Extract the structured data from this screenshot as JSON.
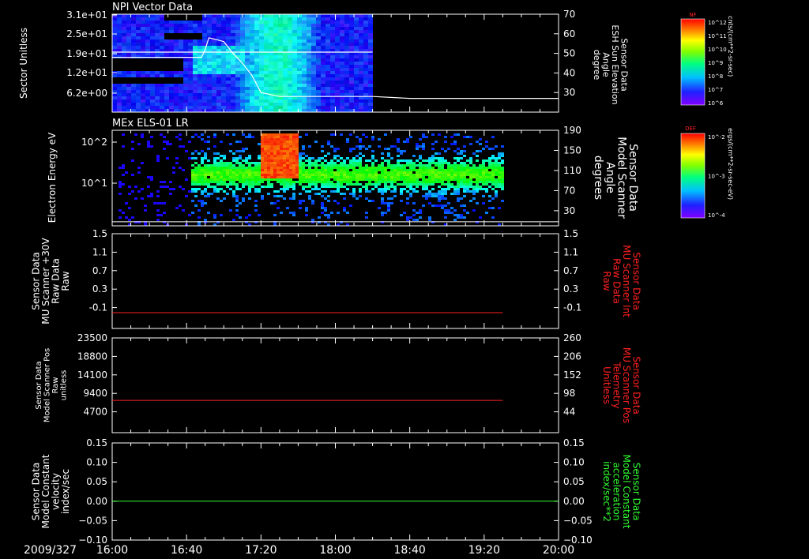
{
  "date_label": "2009/327",
  "time_axis": {
    "start": "16:00",
    "end": "20:00",
    "ticks": [
      "16:00",
      "16:40",
      "17:20",
      "18:00",
      "18:40",
      "19:20",
      "20:00"
    ]
  },
  "colorbars": [
    {
      "label": "NF",
      "units": "cnts/(cm**2-sr-sec)",
      "ticks": [
        "10^12",
        "10^11",
        "10^10",
        "10^9",
        "10^8",
        "10^7",
        "10^6"
      ]
    },
    {
      "label": "DEF",
      "units": "ergs/(cm**2-sr-sec-eV)",
      "ticks": [
        "10^-2",
        "10^-3",
        "10^-4"
      ]
    }
  ],
  "chart_data": [
    {
      "type": "heatmap",
      "title": "NPI Vector Data",
      "ylabel": "Sector Unitless",
      "yticks": [
        "3.1e+01",
        "2.5e+01",
        "1.9e+01",
        "1.2e+01",
        "6.2e+00"
      ],
      "right_axis": {
        "label_lines": [
          "Sensor Data",
          "ESH Sun Elevation",
          "Angle",
          "degree"
        ],
        "ticks": [
          70,
          60,
          50,
          40,
          30
        ],
        "ylim": [
          20,
          70
        ]
      },
      "data_end": "18:20",
      "line_series": {
        "x": [
          "16:00",
          "16:40",
          "16:48",
          "16:50",
          "16:52",
          "16:56",
          "17:00",
          "17:05",
          "17:10",
          "17:15",
          "17:20",
          "17:30",
          "17:50",
          "18:20",
          "18:40",
          "19:30",
          "20:00"
        ],
        "y": [
          48,
          48,
          48,
          52,
          58,
          57,
          56,
          50,
          45,
          39,
          30,
          28,
          28,
          28,
          27,
          27,
          27
        ]
      }
    },
    {
      "type": "heatmap",
      "title": "MEx ELS-01 LR",
      "ylabel": "Electron Energy eV",
      "yticks": [
        "10^2",
        "10^1"
      ],
      "right_axis": {
        "label_lines": [
          "Sensor Data",
          "Model Scanner",
          "Angle",
          "degrees"
        ],
        "ticks": [
          190,
          150,
          110,
          70,
          30
        ],
        "ylim": [
          0,
          190
        ]
      },
      "data_end": "19:30",
      "line_series": {
        "x": [
          "16:00",
          "20:00"
        ],
        "y": [
          8,
          8
        ]
      }
    },
    {
      "type": "line",
      "ylabel_lines": [
        "Sensor Data",
        "MU Scanner +30V",
        "Raw Data",
        "Raw"
      ],
      "ylim": [
        -0.3,
        1.5
      ],
      "yticks": [
        1.5,
        1.1,
        0.7,
        0.3,
        -0.1
      ],
      "right_axis": {
        "label_lines": [
          "Sensor Data",
          "MU Scanner Int",
          "Raw Data",
          "Raw"
        ],
        "ticks": [
          1.5,
          1.1,
          0.7,
          0.3,
          -0.1
        ],
        "color": "#ff2020"
      },
      "series": [
        {
          "color": "#ff2020",
          "x": [
            "16:00",
            "19:30"
          ],
          "y": [
            0.0,
            0.0
          ]
        }
      ]
    },
    {
      "type": "line",
      "ylabel_lines": [
        "Sensor Data",
        "Model Scanner Pos",
        "Raw",
        "unitless"
      ],
      "ylim": [
        0,
        23500
      ],
      "yticks": [
        23500,
        18800,
        14100,
        9400,
        4700
      ],
      "right_axis": {
        "label_lines": [
          "Sensor Data",
          "MU Scanner Pos",
          "Telemetry",
          "Unitless"
        ],
        "ticks": [
          260,
          206,
          152,
          98,
          44
        ],
        "color": "#ff2020"
      },
      "series": [
        {
          "color": "#ff2020",
          "x": [
            "16:00",
            "19:30"
          ],
          "y": [
            8000,
            8000
          ]
        }
      ]
    },
    {
      "type": "line",
      "ylabel_lines": [
        "Sensor Data",
        "Model Constant",
        "velocity",
        "index/sec"
      ],
      "ylim": [
        -0.1,
        0.15
      ],
      "yticks": [
        "0.15",
        "0.10",
        "0.05",
        "0.00",
        "−0.05",
        "−0.10"
      ],
      "right_axis": {
        "label_lines": [
          "Sensor Data",
          "Model Constant",
          "acceleration",
          "index/sec**2"
        ],
        "ticks": [
          "0.15",
          "0.10",
          "0.05",
          "0.00",
          "−0.05",
          "−0.10"
        ],
        "color": "#30ff30"
      },
      "series": [
        {
          "color": "#30ff30",
          "x": [
            "16:00",
            "20:00"
          ],
          "y": [
            0.0,
            0.0
          ]
        }
      ]
    }
  ]
}
